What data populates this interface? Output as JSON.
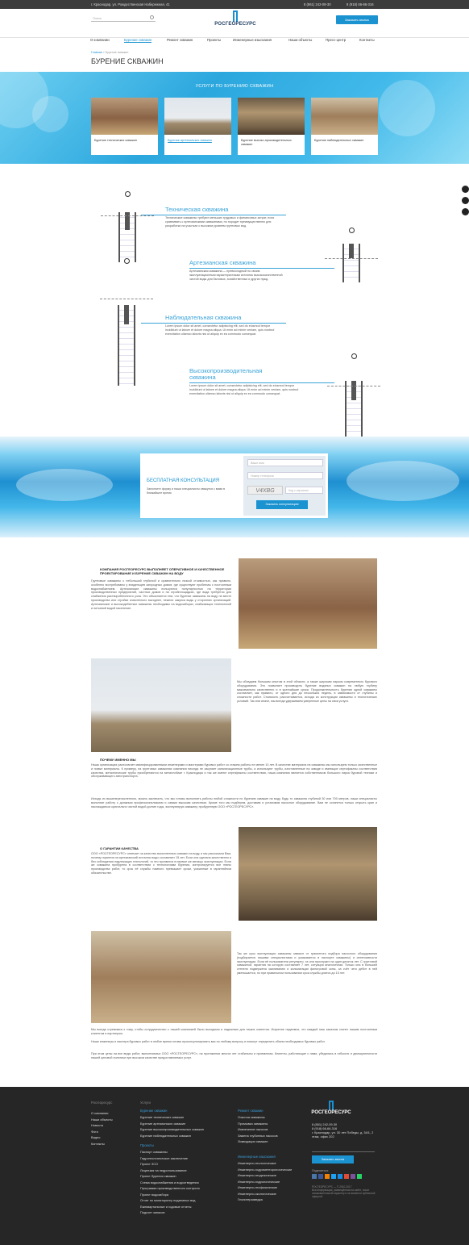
{
  "topbar": {
    "address": "г. Краснодар, ул. Рождественская Набережная, 41",
    "phone1": "8 (861) 242-09-30",
    "phone2": "8 (918) 66-66-316"
  },
  "header": {
    "search_placeholder": "Поиск",
    "logo_text": "РОСГЕОРЕСУРС",
    "cta_label": "Заказать звонок"
  },
  "nav": {
    "items": [
      "О компании",
      "Бурение скважин",
      "Ремонт скважин",
      "Проекты",
      "Инженерные изыскания",
      "Наши объекты",
      "Пресс-центр",
      "Контакты"
    ]
  },
  "breadcrumb": {
    "home": "Главная",
    "sep": "»",
    "current": "Бурение скважин"
  },
  "page_title": "БУРЕНИЕ СКВАЖИН",
  "services": {
    "title": "УСЛУГИ ПО БУРЕНИЮ СКВАЖИН",
    "cards": [
      {
        "label": "Бурение технических скважин"
      },
      {
        "label": "Бурение артезианских скважин"
      },
      {
        "label": "Бурение высоко-производительных скважин"
      },
      {
        "label": "Бурение наблюдательных скважин"
      }
    ]
  },
  "schemas": [
    {
      "title": "Техническая скважина",
      "text": "Технические скважины требуют меньших трудовых и финансовых затрат, если сравнивать с артезианскими скважинами, но породит преимущественно для разработки на участках с высоким уровнем грунтовых вод."
    },
    {
      "title": "Артезианская скважина",
      "text": "Артезианская скважина — превосходный по своим эксплуатационным характеристикам источник высококачественной чистой воды для бытовых, хозяйственных и других нужд."
    },
    {
      "title": "Наблюдательная скважина",
      "text": "Lorem ipsum dolor sit amet, consectetur adipisicing elit, sed do eiusmod tempor incididunt ut labore et dolore magna aliqua. Ut enim ad minim veniam, quis nostrud exercitation ullamco laboris nisi ut aliquip ex ea commodo consequat."
    },
    {
      "title": "Высокопроизводительная скважина",
      "text": "Lorem ipsum dolor sit amet, consectetur adipisicing elit, sed do eiusmod tempor incididunt ut labore et dolore magna aliqua. Ut enim ad minim veniam, quis nostrud exercitation ullamco laboris nisi ut aliquip ex ea commodo consequat."
    }
  ],
  "consult": {
    "title": "БЕСПЛАТНАЯ КОНСУЛЬТАЦИЯ",
    "desc": "Заполните форму и наши специалисты свяжутся с вами в ближайшее время",
    "name_placeholder": "Ваше имя",
    "phone_placeholder": "Номер телефона",
    "captcha": "V4XBG",
    "code_placeholder": "Код с картинки",
    "submit": "Заказать консультацию"
  },
  "article": {
    "h1": "КОМПАНИЯ РОСГЕОРЕСУРС ВЫПОЛНЯЕТ ОПЕРАТИВНОЕ И КАЧЕСТВЕННОЕ ПРОЕКТИРОВАНИЕ И БУРЕНИЕ СКВАЖИН НА ВОДУ",
    "p1": "Грунтовые скважины с небольшой глубиной и сравнительно низкой стоимостью, как правило, особенно востребованы у владельцев загородных домов, где существуют проблемы с постоянным водоснабжением. Артезианские скважины пользуются популярностью на территории производственных предприятий, частных домов и на стройплощадках, где вода требуется для снабжения растворобетонного узла. Это объясняется тем, что бурение скважины на воду на месте производства или стройки значительно выгоднее, нежели закупка воды у сторонних организаций. Артезианские и высокодебитные скважины необходимы на водозаборах, снабжающих технической и питьевой водой население.",
    "p2": "Мы обладаем большим опытом в этой области, а также широким парком современного бурового оборудования. Это позволяет производить бурение водяных скважин на любую глубину максимально качественно и в кратчайшие сроки. Продолжительность бурения одной скважины составляет, как правило, от одного дня до нескольких недель, в зависимости от глубины и сложности работ. Стоимость рассчитывается, исходя из конструкции скважины и геологических условий. Так или иначе, мы всегда удерживаем умеренные цены на свои услуги.",
    "h2": "ПОЧЕМУ ИМЕННО МЫ",
    "p3": "Наша организация располагает квалифицированными инженерами и мастерами буровых работ со стажем работы не менее 10 лет. В качестве материала на скважины мы используем только качественные и новые материалы. К примеру, на грунтовых скважинах компания никогда не закупает канализационные трубы, а используют трубы, изготовленные на заводе и имеющие сертификаты соответствия качества, металлические трубы приобретаются на металлобазе г. Краснодара и так же имеют сертификаты соответствия, наша компания является собственником большого парка буровой техники и обслуживающего автотранспорта.",
    "p4": "Исходя из вышеперечисленного, можно заключить, что мы готовы выполнить работы любой сложности по бурению скважин на воду. Будь то скважина глубиной 30 или 700 метров, наши специалисты выполнят работу с должным профессионализмом и самым высоким качеством. Кроме того мы подберем, доставим и установим насосное оборудование. Вам не останется только открыть кран и наслаждаться кристально чистой водой долгие годы, эксплуатируя скважину, пробуренную ООО «РОСГЕОРЕСУРС».",
    "h3": "О ГАРАНТИИ КАЧЕСТВА",
    "p5": "ООО «РОСГЕОРЕСУРС» отвечает за качество выполненных скважин на воду, и мы рассказали Вам, почему гарантия на артезианский источник воды составляет 15 лет. Если она сделана качественно и без соблюдения надлежащих технологий, то это проявится в первые же месяцы эксплуатации. Если же скважина пробурена в соответствии с технологиями бурения, контролируется все этапы производства работ, то срок её службы намного превышает сроки, указанные в гарантийном обязательстве.",
    "p6": "Так же срок эксплуатации скважины зависит от грамотного подбора насосного оборудования (подбирается нашими специалистами и указывается в паспорте скважины) и интенсивности эксплуатации. Если её пользователи регулярно, та она прослужит на один десяток лет. С грунтовой скважиной, гарантия на которую составляет 7 лет, ситуация аналогичная. Только она в большей степени подвержена заиливанию и кольматации фильтровой зоны, за счёт чего дебит в ней уменьшается, но при правильном пользовании срок службы длится до 15 лет.",
    "p7": "Мы всегда стремимся к тому, чтобы сотрудничество с нашей компанией было выгодным и надежным для наших клиентов. Искренне надеемся, что каждый наш заказчик станет нашим постоянным клиентом и партнером.",
    "p8": "Наши инженеры и мастера буровых работ в любое время готовы проконсультировать вас по любому вопросу и помогут определить объем необходимых буровых работ.",
    "p9": "При этом цены на все виды работ, выполняемых ООО «РОСГЕОРЕСУРС», на протяжении многих лет стабильны и приемлемы. Клиенты, работающие с нами, убедились в гибкости и демократичности нашей ценовой политики при высоком качестве предоставляемых услуг."
  },
  "footer": {
    "col1_title": "Росгеоресурс",
    "col1": [
      "О компании",
      "Наши объекты",
      "Новости",
      "Фото",
      "Видео",
      "Контакты"
    ],
    "col2_title": "Услуги",
    "col2_sub": "Бурение скважин",
    "col2": [
      "Бурение технических скважин",
      "Бурение артезианских скважин",
      "Бурение высокопроизводительных скважин",
      "Бурение наблюдательных скважин"
    ],
    "col2b_sub": "Проекты",
    "col2b": [
      "Паспорт скважины",
      "Гидрогеологическое заключение",
      "Проект ЗСО",
      "Лицензия на недропользование",
      "Проект бурения скважин",
      "Схема водоснабжения и водоотведения",
      "Программа производственного контроля",
      "Проект водозабора",
      "Отчет по мониторингу подземных вод",
      "Ежеквартальные и годовые отчеты",
      "Подсчет запасов"
    ],
    "col3_sub": "Ремонт скважин",
    "col3": [
      "Очистка скважины",
      "Промывка скважины",
      "Извлечение насосов",
      "Замена глубинных насосов",
      "Ликвидация скважин"
    ],
    "col3b_sub": "Инженерные изыскания",
    "col3b": [
      "Инженерно-геологические",
      "Инженерно-гидрометеорологические",
      "Инженерно-геодезические",
      "Инженерно-гидрологические",
      "Инженерно-геофизические",
      "Инженерно-экологические",
      "Геолитеразведка"
    ],
    "logo_text": "РОСГЕОРЕСУРС",
    "phone1": "8 (861) 242-09-30",
    "phone2": "8 (918) 66-66-316",
    "address": "г. Краснодар, ул. 30 лет Победы, д. 34/1, 2 этаж, офис 202",
    "cta": "Заказать звонок",
    "share": "Поделиться",
    "copyright": "РОСГЕОРЕСУРС — © 2010-2017",
    "disclaimer": "Вся информация, размещённая на сайте, носит ознакомительный характер и не является публичной офертой."
  },
  "colors": {
    "accent": "#1b93d1",
    "dark": "#262626",
    "schema": "#3aa3d9"
  }
}
